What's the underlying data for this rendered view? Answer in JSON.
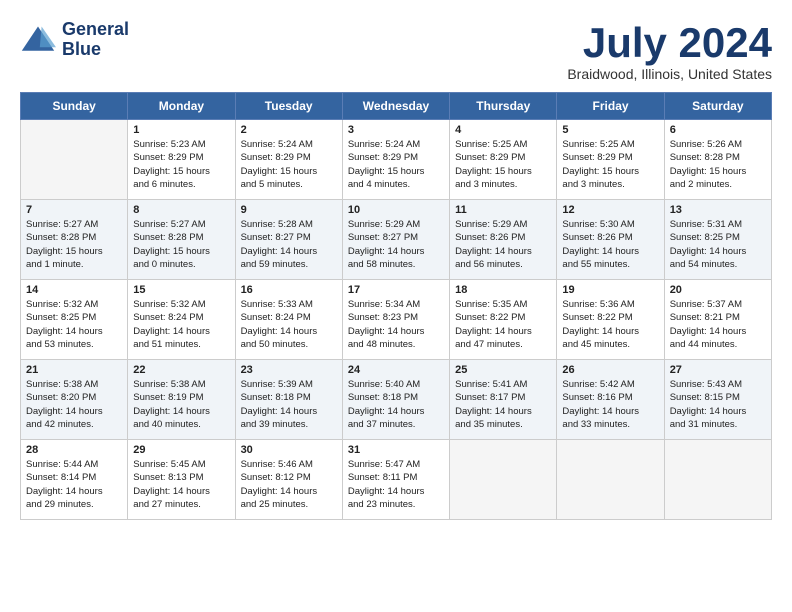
{
  "logo": {
    "line1": "General",
    "line2": "Blue"
  },
  "title": "July 2024",
  "location": "Braidwood, Illinois, United States",
  "days_of_week": [
    "Sunday",
    "Monday",
    "Tuesday",
    "Wednesday",
    "Thursday",
    "Friday",
    "Saturday"
  ],
  "weeks": [
    [
      {
        "day": "",
        "info": ""
      },
      {
        "day": "1",
        "info": "Sunrise: 5:23 AM\nSunset: 8:29 PM\nDaylight: 15 hours\nand 6 minutes."
      },
      {
        "day": "2",
        "info": "Sunrise: 5:24 AM\nSunset: 8:29 PM\nDaylight: 15 hours\nand 5 minutes."
      },
      {
        "day": "3",
        "info": "Sunrise: 5:24 AM\nSunset: 8:29 PM\nDaylight: 15 hours\nand 4 minutes."
      },
      {
        "day": "4",
        "info": "Sunrise: 5:25 AM\nSunset: 8:29 PM\nDaylight: 15 hours\nand 3 minutes."
      },
      {
        "day": "5",
        "info": "Sunrise: 5:25 AM\nSunset: 8:29 PM\nDaylight: 15 hours\nand 3 minutes."
      },
      {
        "day": "6",
        "info": "Sunrise: 5:26 AM\nSunset: 8:28 PM\nDaylight: 15 hours\nand 2 minutes."
      }
    ],
    [
      {
        "day": "7",
        "info": "Sunrise: 5:27 AM\nSunset: 8:28 PM\nDaylight: 15 hours\nand 1 minute."
      },
      {
        "day": "8",
        "info": "Sunrise: 5:27 AM\nSunset: 8:28 PM\nDaylight: 15 hours\nand 0 minutes."
      },
      {
        "day": "9",
        "info": "Sunrise: 5:28 AM\nSunset: 8:27 PM\nDaylight: 14 hours\nand 59 minutes."
      },
      {
        "day": "10",
        "info": "Sunrise: 5:29 AM\nSunset: 8:27 PM\nDaylight: 14 hours\nand 58 minutes."
      },
      {
        "day": "11",
        "info": "Sunrise: 5:29 AM\nSunset: 8:26 PM\nDaylight: 14 hours\nand 56 minutes."
      },
      {
        "day": "12",
        "info": "Sunrise: 5:30 AM\nSunset: 8:26 PM\nDaylight: 14 hours\nand 55 minutes."
      },
      {
        "day": "13",
        "info": "Sunrise: 5:31 AM\nSunset: 8:25 PM\nDaylight: 14 hours\nand 54 minutes."
      }
    ],
    [
      {
        "day": "14",
        "info": "Sunrise: 5:32 AM\nSunset: 8:25 PM\nDaylight: 14 hours\nand 53 minutes."
      },
      {
        "day": "15",
        "info": "Sunrise: 5:32 AM\nSunset: 8:24 PM\nDaylight: 14 hours\nand 51 minutes."
      },
      {
        "day": "16",
        "info": "Sunrise: 5:33 AM\nSunset: 8:24 PM\nDaylight: 14 hours\nand 50 minutes."
      },
      {
        "day": "17",
        "info": "Sunrise: 5:34 AM\nSunset: 8:23 PM\nDaylight: 14 hours\nand 48 minutes."
      },
      {
        "day": "18",
        "info": "Sunrise: 5:35 AM\nSunset: 8:22 PM\nDaylight: 14 hours\nand 47 minutes."
      },
      {
        "day": "19",
        "info": "Sunrise: 5:36 AM\nSunset: 8:22 PM\nDaylight: 14 hours\nand 45 minutes."
      },
      {
        "day": "20",
        "info": "Sunrise: 5:37 AM\nSunset: 8:21 PM\nDaylight: 14 hours\nand 44 minutes."
      }
    ],
    [
      {
        "day": "21",
        "info": "Sunrise: 5:38 AM\nSunset: 8:20 PM\nDaylight: 14 hours\nand 42 minutes."
      },
      {
        "day": "22",
        "info": "Sunrise: 5:38 AM\nSunset: 8:19 PM\nDaylight: 14 hours\nand 40 minutes."
      },
      {
        "day": "23",
        "info": "Sunrise: 5:39 AM\nSunset: 8:18 PM\nDaylight: 14 hours\nand 39 minutes."
      },
      {
        "day": "24",
        "info": "Sunrise: 5:40 AM\nSunset: 8:18 PM\nDaylight: 14 hours\nand 37 minutes."
      },
      {
        "day": "25",
        "info": "Sunrise: 5:41 AM\nSunset: 8:17 PM\nDaylight: 14 hours\nand 35 minutes."
      },
      {
        "day": "26",
        "info": "Sunrise: 5:42 AM\nSunset: 8:16 PM\nDaylight: 14 hours\nand 33 minutes."
      },
      {
        "day": "27",
        "info": "Sunrise: 5:43 AM\nSunset: 8:15 PM\nDaylight: 14 hours\nand 31 minutes."
      }
    ],
    [
      {
        "day": "28",
        "info": "Sunrise: 5:44 AM\nSunset: 8:14 PM\nDaylight: 14 hours\nand 29 minutes."
      },
      {
        "day": "29",
        "info": "Sunrise: 5:45 AM\nSunset: 8:13 PM\nDaylight: 14 hours\nand 27 minutes."
      },
      {
        "day": "30",
        "info": "Sunrise: 5:46 AM\nSunset: 8:12 PM\nDaylight: 14 hours\nand 25 minutes."
      },
      {
        "day": "31",
        "info": "Sunrise: 5:47 AM\nSunset: 8:11 PM\nDaylight: 14 hours\nand 23 minutes."
      },
      {
        "day": "",
        "info": ""
      },
      {
        "day": "",
        "info": ""
      },
      {
        "day": "",
        "info": ""
      }
    ]
  ]
}
